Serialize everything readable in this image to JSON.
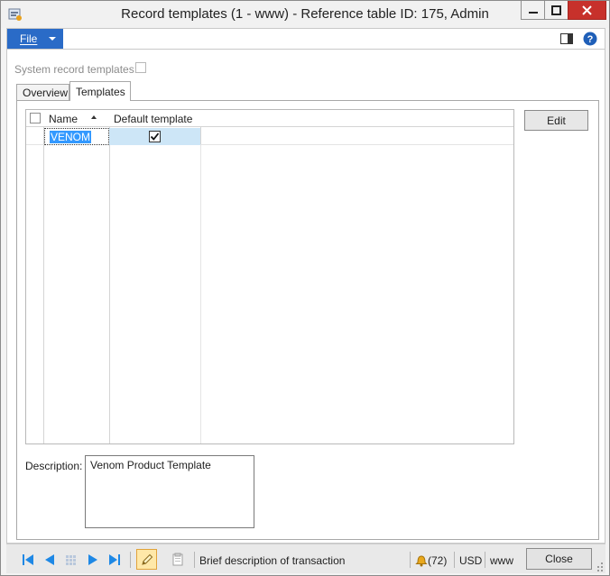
{
  "window": {
    "title": "Record templates (1 - www) - Reference table ID: 175, Admin"
  },
  "ribbon": {
    "file_label": "File"
  },
  "form": {
    "system_record_templates_label": "System record templates:",
    "system_record_templates_checked": false,
    "tabs": [
      {
        "label": "Overview",
        "active": false
      },
      {
        "label": "Templates",
        "active": true
      }
    ],
    "grid": {
      "columns": [
        "Name",
        "Default template"
      ],
      "rows": [
        {
          "name": "VENOM",
          "default_template": true,
          "selected": true
        }
      ]
    },
    "edit_button": "Edit",
    "description_label": "Description:",
    "description_value": "Venom Product Template"
  },
  "statusbar": {
    "transaction_text": "Brief description of transaction",
    "notifications": "(72)",
    "currency": "USD",
    "company": "www",
    "close_label": "Close"
  },
  "colors": {
    "file_button": "#2a6bc7",
    "close_window_button": "#c7312b",
    "selection_highlight": "#cde6f7",
    "text_selection": "#3399ff",
    "nav_arrows": "#1e88e5"
  }
}
